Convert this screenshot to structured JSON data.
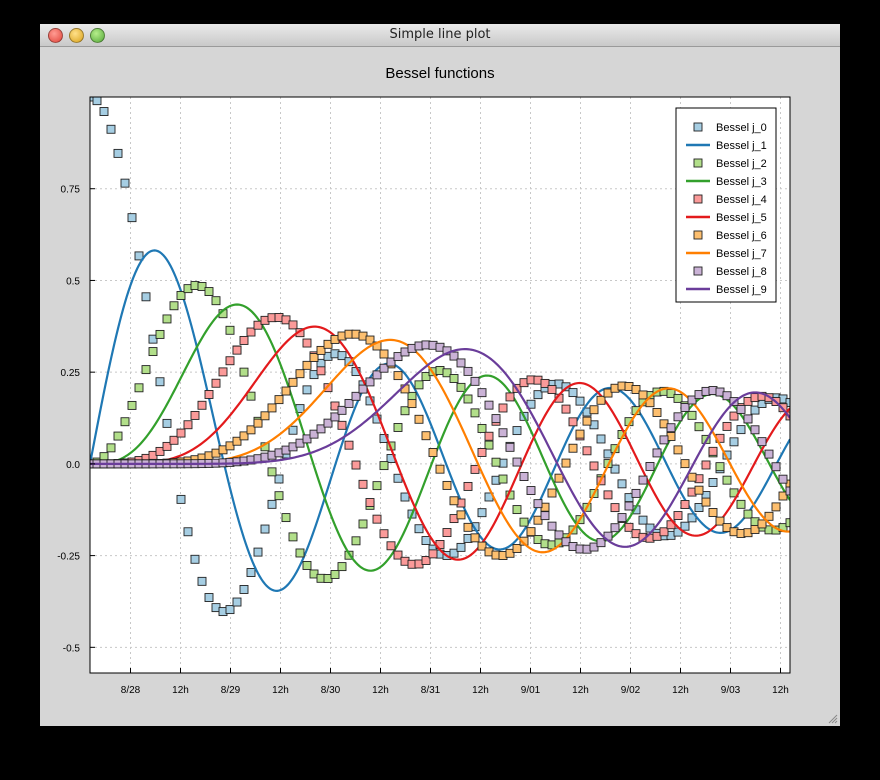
{
  "window": {
    "title": "Simple line plot"
  },
  "icons": {
    "close": "close-button-icon",
    "minimize": "minimize-button-icon",
    "maximize": "maximize-button-icon",
    "resize": "resize-grip-icon"
  },
  "chart_data": {
    "type": "line",
    "title": "Bessel functions",
    "xlabel": "",
    "ylabel": "",
    "x_axis": {
      "kind": "time",
      "range": [
        "8/27 12h",
        "9/04 00h"
      ],
      "tick_labels": [
        "8/28",
        "12h",
        "8/29",
        "12h",
        "8/30",
        "12h",
        "8/31",
        "12h",
        "9/01",
        "12h",
        "9/02",
        "12h",
        "9/03",
        "12h"
      ]
    },
    "y_axis": {
      "range": [
        -0.57,
        1.0
      ],
      "ticks": [
        -0.5,
        -0.25,
        0.0,
        0.25,
        0.5,
        0.75
      ],
      "tick_labels": [
        "-0.5",
        "-0.25",
        "0.0",
        "0.25",
        "0.5",
        "0.75"
      ]
    },
    "grid": true,
    "legend": {
      "placement": "top-right"
    },
    "series": [
      {
        "name": "Bessel j_0",
        "order": 0,
        "style": "markers",
        "color": "#a6cee3"
      },
      {
        "name": "Bessel j_1",
        "order": 1,
        "style": "line",
        "color": "#1f78b4"
      },
      {
        "name": "Bessel j_2",
        "order": 2,
        "style": "markers",
        "color": "#b2df8a"
      },
      {
        "name": "Bessel j_3",
        "order": 3,
        "style": "line",
        "color": "#33a02c"
      },
      {
        "name": "Bessel j_4",
        "order": 4,
        "style": "markers",
        "color": "#fb9a99"
      },
      {
        "name": "Bessel j_5",
        "order": 5,
        "style": "line",
        "color": "#e31a1c"
      },
      {
        "name": "Bessel j_6",
        "order": 6,
        "style": "markers",
        "color": "#fdbf6f"
      },
      {
        "name": "Bessel j_7",
        "order": 7,
        "style": "line",
        "color": "#ff7f00"
      },
      {
        "name": "Bessel j_8",
        "order": 8,
        "style": "markers",
        "color": "#cab2d6"
      },
      {
        "name": "Bessel j_9",
        "order": 9,
        "style": "line",
        "color": "#6a3d9a"
      }
    ]
  }
}
